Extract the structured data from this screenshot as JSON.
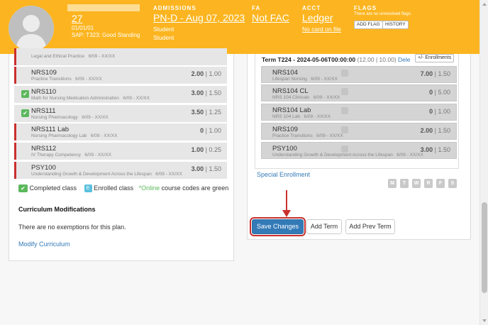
{
  "header": {
    "student_id": "27",
    "date": "01/01/01",
    "sap": "SAP: T323: Good Standing",
    "admissions": {
      "title": "ADMISSIONS",
      "value": "PN-D - Aug 07, 2023",
      "line1": "Student",
      "line2": "Student"
    },
    "fa": {
      "title": "FA",
      "value": "Not FAC"
    },
    "acct": {
      "title": "ACCT",
      "value": "Ledger",
      "sub": "No card on file"
    },
    "flags": {
      "title": "FLAGS",
      "note": "There are no unresolved flags.",
      "add_flag": "ADD FLAG",
      "history": "HISTORY"
    }
  },
  "left": {
    "courses": [
      {
        "code": "",
        "desc": "Legal and Ethical Practice",
        "dates": "6/09 - XX/XX",
        "cred": "",
        "done": false
      },
      {
        "code": "NRS109",
        "desc": "Practice Transitions",
        "dates": "6/09 - XX/XX",
        "cred": "2.00",
        "hrs": "1.00",
        "done": false
      },
      {
        "code": "NRS110",
        "desc": "Math for Nursing Medication Administration",
        "dates": "6/09 - XX/XX",
        "cred": "3.00",
        "hrs": "1.50",
        "done": true
      },
      {
        "code": "NRS111",
        "desc": "Nursing Pharmacology",
        "dates": "6/09 - XX/XX",
        "cred": "3.50",
        "hrs": "1.25",
        "done": true
      },
      {
        "code": "NRS111 Lab",
        "desc": "Nursing Pharmacology Lab",
        "dates": "6/09 - XX/XX",
        "cred": "0",
        "hrs": "1.00",
        "done": false
      },
      {
        "code": "NRS112",
        "desc": "IV Therapy Competency",
        "dates": "6/09 - XX/XX",
        "cred": "1.00",
        "hrs": "0.25",
        "done": false
      },
      {
        "code": "PSY100",
        "desc": "Understanding Growth & Development Across the Lifespan",
        "dates": "6/09 - XX/XX",
        "cred": "3.00",
        "hrs": "1.50",
        "done": false
      }
    ],
    "legend": {
      "completed": "Completed class",
      "enrolled": "Enrolled class",
      "online_prefix": "*",
      "online_word": "Online",
      "online_suffix": " course codes are green",
      "e": "E"
    },
    "curriculum_title": "Curriculum Modifications",
    "curriculum_text": "There are no exemptions for this plan.",
    "modify_link": "Modify Curriculum"
  },
  "right": {
    "term_title": "Term T224 - 2024-05-06T00:00:00",
    "term_credits": "(12.00 | 10.00)",
    "term_delete": "Dele",
    "enrollments_btn": "+/- Enrollments",
    "courses": [
      {
        "code": "NRS104",
        "desc": "Lifespan Nursing",
        "dates": "6/09 - XX/XX",
        "cred": "7.00",
        "hrs": "1.50"
      },
      {
        "code": "NRS104 CL",
        "desc": "NRS 104 Clinicals",
        "dates": "6/09 - XX/XX",
        "cred": "0",
        "hrs": "5.00"
      },
      {
        "code": "NRS104 Lab",
        "desc": "NRS 104 Lab",
        "dates": "6/09 - XX/XX",
        "cred": "0",
        "hrs": "1.00"
      },
      {
        "code": "NRS109",
        "desc": "Practice Transitions",
        "dates": "6/09 - XX/XX",
        "cred": "2.00",
        "hrs": "1.50"
      },
      {
        "code": "PSY100",
        "desc": "Understanding Growth & Development Across the Lifespan",
        "dates": "6/09 - XX/XX",
        "cred": "3.00",
        "hrs": "1.50"
      }
    ],
    "special_enrollment": "Special Enrollment",
    "days": [
      "M",
      "T",
      "W",
      "R",
      "F",
      "S"
    ],
    "save": "Save Changes",
    "add_term": "Add Term",
    "add_prev_term": "Add Prev Term"
  },
  "colors": {
    "header": "#fcb520",
    "primary": "#337ab7",
    "danger": "#c9302c",
    "success": "#5cb85c",
    "info": "#5bc0de"
  }
}
